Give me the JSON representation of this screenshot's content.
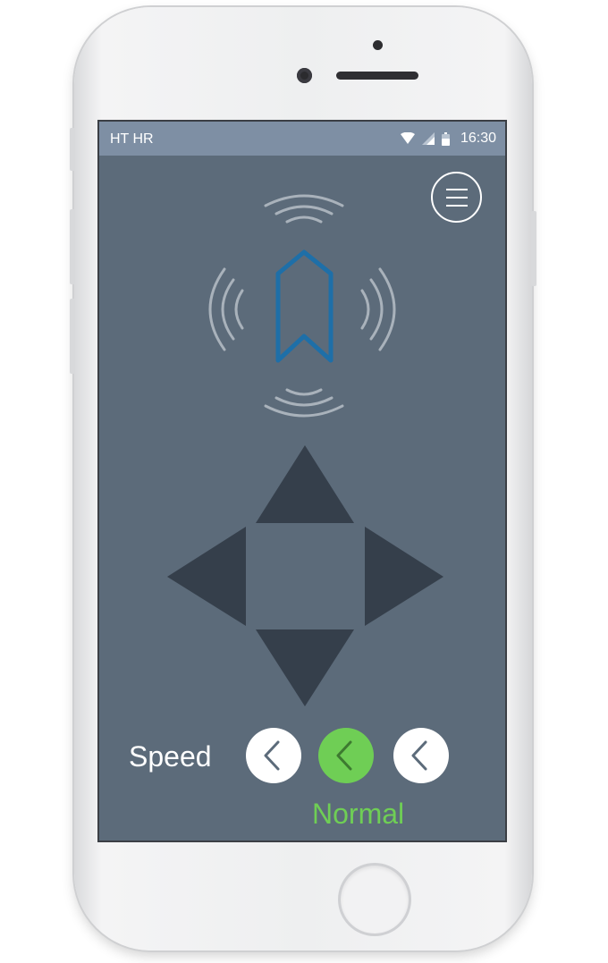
{
  "status_bar": {
    "carrier": "HT HR",
    "time": "16:30",
    "icons": [
      "wifi-icon",
      "signal-icon",
      "battery-icon"
    ]
  },
  "header": {
    "menu_icon": "hamburger-menu-icon"
  },
  "robot": {
    "icon": "robot-arrow-icon",
    "signal_icons": [
      "signal-waves-top-icon",
      "signal-waves-left-icon",
      "signal-waves-right-icon",
      "signal-waves-bottom-icon"
    ]
  },
  "dpad": {
    "buttons": [
      "up",
      "left",
      "right",
      "down"
    ]
  },
  "speed": {
    "label": "Speed",
    "levels": 3,
    "selected_index": 1,
    "selected_label": "Normal"
  },
  "colors": {
    "screen_background": "#5c6b7a",
    "status_bar": "#7e8fa4",
    "dpad": "#353f4b",
    "accent_green": "#6fce55",
    "robot_blue": "#1e6fa8",
    "waves": "#a9b2bb"
  }
}
